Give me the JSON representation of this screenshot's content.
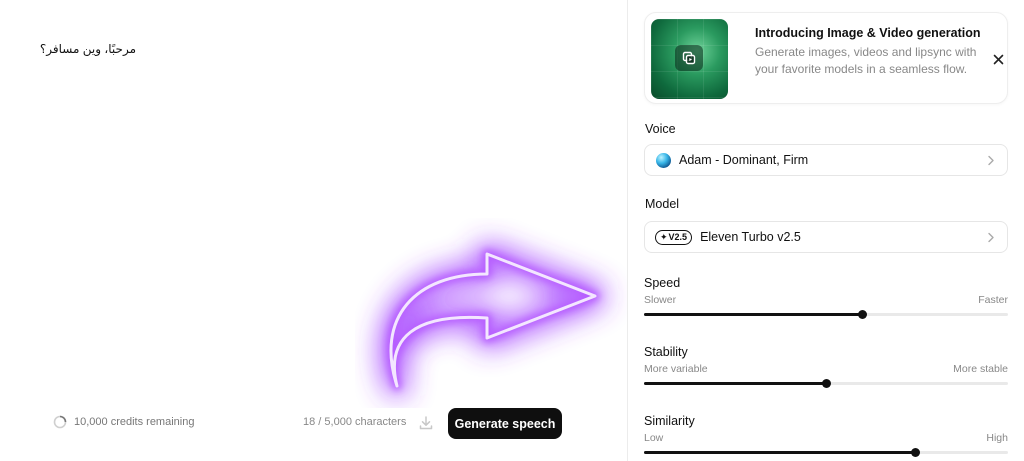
{
  "editor": {
    "text": "مرحبًا، وين مسافر؟"
  },
  "footer": {
    "credits_text": "10,000 credits remaining",
    "char_count": "18 / 5,000 characters",
    "generate_label": "Generate speech"
  },
  "promo": {
    "title": "Introducing Image & Video generation",
    "description": "Generate images, videos and lipsync with your favorite models in a seamless flow."
  },
  "voice": {
    "label": "Voice",
    "selected": "Adam - Dominant, Firm"
  },
  "model": {
    "label": "Model",
    "badge": "V2.5",
    "selected": "Eleven Turbo v2.5"
  },
  "sliders": [
    {
      "title": "Speed",
      "min_label": "Slower",
      "max_label": "Faster",
      "value": 0.6
    },
    {
      "title": "Stability",
      "min_label": "More variable",
      "max_label": "More stable",
      "value": 0.5
    },
    {
      "title": "Similarity",
      "min_label": "Low",
      "max_label": "High",
      "value": 0.745
    }
  ],
  "colors": {
    "primary_button": "#0f0f0f",
    "accent_glow": "#a855f7"
  },
  "icons": {
    "credits": "loading-circle-icon",
    "download": "download-icon",
    "promo": "gallery-icon",
    "close": "close-icon",
    "chevron": "chevron-right-icon",
    "arrow": "neon-arrow-icon"
  }
}
